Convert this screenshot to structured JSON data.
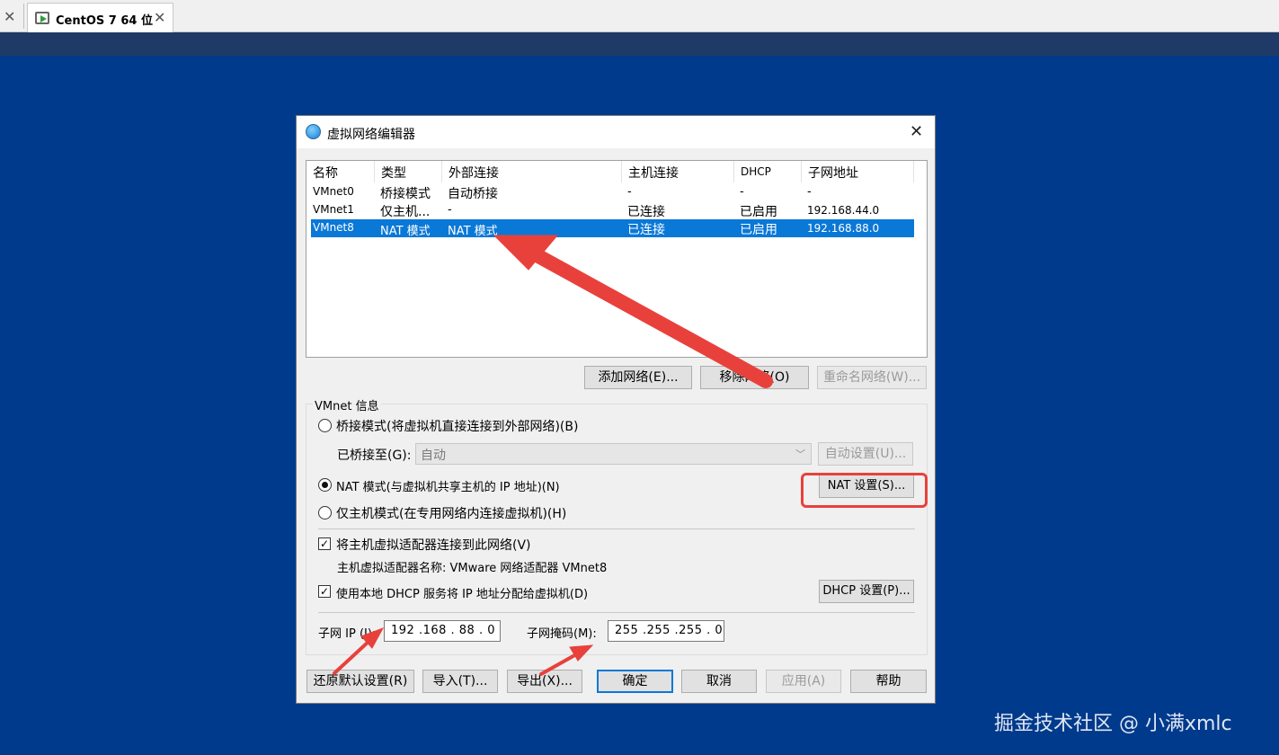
{
  "tab": {
    "title": "CentOS 7 64 位"
  },
  "dialog": {
    "title": "虚拟网络编辑器",
    "columns": [
      "名称",
      "类型",
      "外部连接",
      "主机连接",
      "DHCP",
      "子网地址"
    ],
    "rows": [
      {
        "name": "VMnet0",
        "type": "桥接模式",
        "external": "自动桥接",
        "host": "-",
        "dhcp": "-",
        "subnet": "-",
        "selected": false
      },
      {
        "name": "VMnet1",
        "type": "仅主机...",
        "external": "-",
        "host": "已连接",
        "dhcp": "已启用",
        "subnet": "192.168.44.0",
        "selected": false
      },
      {
        "name": "VMnet8",
        "type": "NAT 模式",
        "external": "NAT 模式",
        "host": "已连接",
        "dhcp": "已启用",
        "subnet": "192.168.88.0",
        "selected": true
      }
    ],
    "buttons": {
      "add_network": "添加网络(E)...",
      "remove_network": "移除网络(O)",
      "rename_network": "重命名网络(W)..."
    },
    "vmnet_info": {
      "label": "VMnet 信息",
      "bridged_option": "桥接模式(将虚拟机直接连接到外部网络)(B)",
      "bridged_to_label": "已桥接至(G):",
      "bridged_to_value": "自动",
      "auto_settings": "自动设置(U)...",
      "nat_option": "NAT 模式(与虚拟机共享主机的 IP 地址)(N)",
      "nat_settings": "NAT 设置(S)...",
      "hostonly_option": "仅主机模式(在专用网络内连接虚拟机)(H)",
      "selected_mode": "nat",
      "connect_adapter": "将主机虚拟适配器连接到此网络(V)",
      "connect_adapter_checked": true,
      "adapter_name": "主机虚拟适配器名称: VMware 网络适配器 VMnet8",
      "use_dhcp": "使用本地 DHCP 服务将 IP 地址分配给虚拟机(D)",
      "use_dhcp_checked": true,
      "dhcp_settings": "DHCP 设置(P)...",
      "subnet_ip_label": "子网 IP (I):",
      "subnet_ip": "192 .168 . 88 .  0",
      "subnet_mask_label": "子网掩码(M):",
      "subnet_mask": "255 .255 .255 .  0"
    },
    "footer": {
      "restore": "还原默认设置(R)",
      "import": "导入(T)...",
      "export": "导出(X)...",
      "ok": "确定",
      "cancel": "取消",
      "apply": "应用(A)",
      "help": "帮助"
    }
  },
  "watermark": "掘金技术社区 @ 小满xmlc",
  "colors": {
    "desktop": "#003a8c",
    "selection": "#0a78d7",
    "annotation": "#e8413c"
  }
}
